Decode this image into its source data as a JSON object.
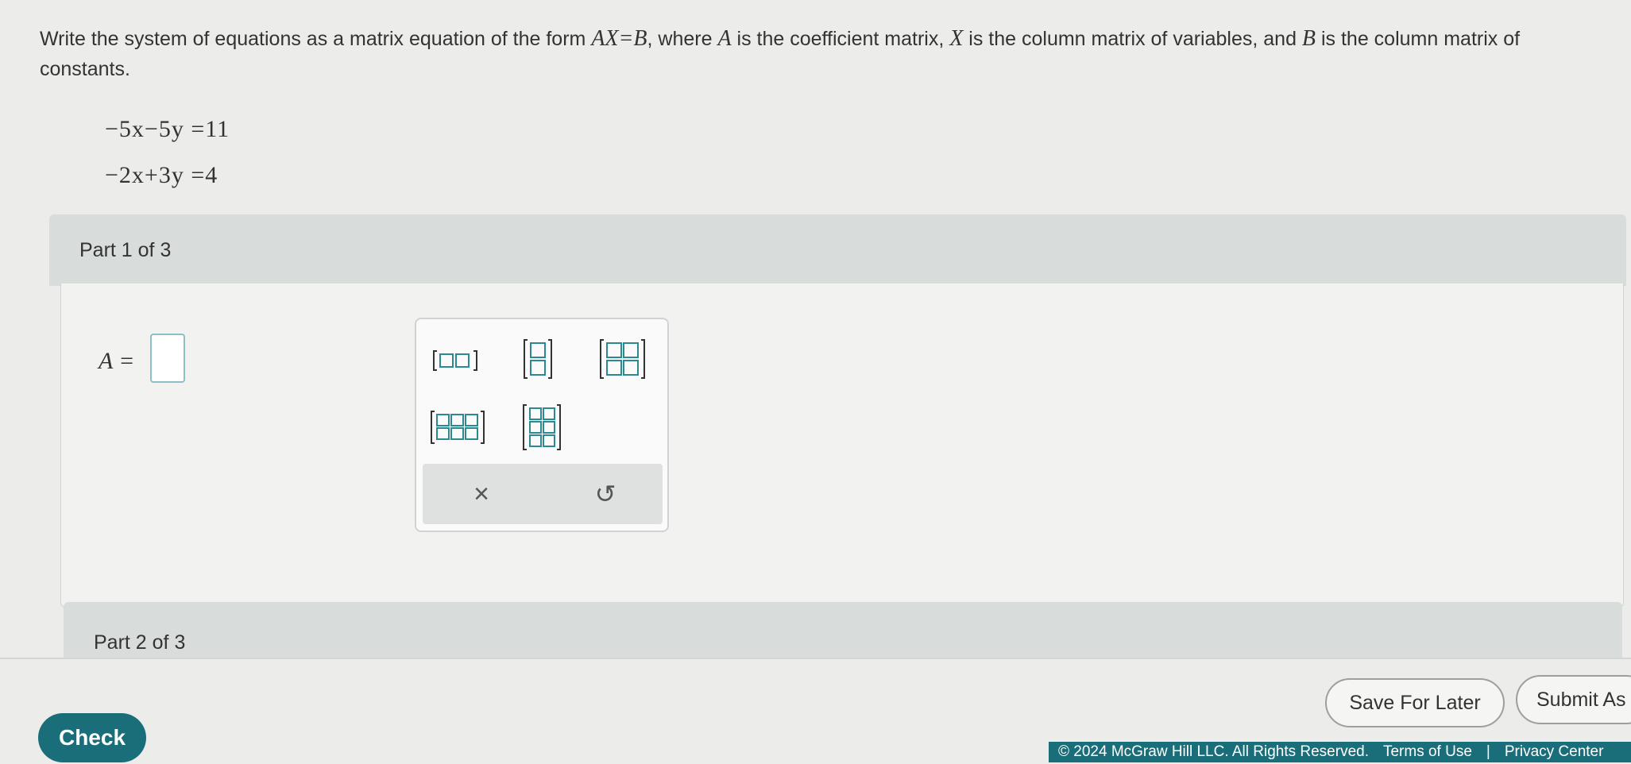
{
  "question": {
    "text_1": "Write the system of equations as a matrix equation of the form ",
    "form": "AX=B",
    "text_2": ", where ",
    "var_a": "A",
    "text_3": " is the coefficient matrix, ",
    "var_x": "X",
    "text_4": " is the column matrix of variables, and ",
    "var_b": "B",
    "text_5": " is the column matrix of constants."
  },
  "equations": [
    "−5x−5y =11",
    "−2x+3y =4"
  ],
  "part1": {
    "label": "Part 1 of 3",
    "answer_label": "A =",
    "answer_value": ""
  },
  "palette": {
    "tools": [
      {
        "name": "matrix-1x2-icon"
      },
      {
        "name": "matrix-2x1-icon"
      },
      {
        "name": "matrix-2x2-icon"
      },
      {
        "name": "matrix-2x3-icon"
      },
      {
        "name": "matrix-3x2-icon"
      }
    ],
    "clear_symbol": "×",
    "undo_symbol": "↺"
  },
  "part2": {
    "label": "Part 2 of 3"
  },
  "buttons": {
    "check": "Check",
    "save": "Save For Later",
    "submit": "Submit As"
  },
  "footer": {
    "copyright": "© 2024 McGraw Hill LLC. All Rights Reserved.",
    "terms": "Terms of Use",
    "separator": "|",
    "privacy": "Privacy Center"
  },
  "colors": {
    "accent": "#1a6e7a",
    "matrix_icon": "#2a8a91",
    "answer_border": "#8dc0c2"
  }
}
